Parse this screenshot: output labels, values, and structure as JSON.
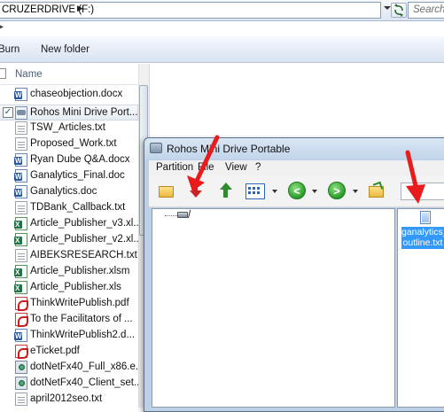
{
  "address_bar": {
    "path": "CRUZERDRIVE (F:)",
    "search_placeholder": "Search"
  },
  "toolbar": {
    "burn_label": "Burn",
    "new_folder_label": "New folder"
  },
  "file_list": {
    "column_header": "Name",
    "files": [
      {
        "name": "chaseobjection.docx",
        "icon": "word-doc-icon",
        "selected": false
      },
      {
        "name": "Rohos Mini Drive Port...",
        "icon": "app-icon",
        "selected": true
      },
      {
        "name": "TSW_Articles.txt",
        "icon": "text-file-icon",
        "selected": false
      },
      {
        "name": "Proposed_Work.txt",
        "icon": "text-file-icon",
        "selected": false
      },
      {
        "name": "Ryan Dube Q&A.docx",
        "icon": "word-doc-icon",
        "selected": false
      },
      {
        "name": "Ganalytics_Final.doc",
        "icon": "word-doc-icon",
        "selected": false
      },
      {
        "name": "Ganalytics.doc",
        "icon": "word-doc-icon",
        "selected": false
      },
      {
        "name": "TDBank_Callback.txt",
        "icon": "text-file-icon",
        "selected": false
      },
      {
        "name": "Article_Publisher_v3.xl...",
        "icon": "excel-file-icon",
        "selected": false
      },
      {
        "name": "Article_Publisher_v2.xl...",
        "icon": "excel-file-icon",
        "selected": false
      },
      {
        "name": "AIBEKSRESEARCH.txt",
        "icon": "text-file-icon",
        "selected": false
      },
      {
        "name": "Article_Publisher.xlsm",
        "icon": "excel-file-icon",
        "selected": false
      },
      {
        "name": "Article_Publisher.xls",
        "icon": "excel-file-icon",
        "selected": false
      },
      {
        "name": "ThinkWritePublish.pdf",
        "icon": "pdf-file-icon",
        "selected": false
      },
      {
        "name": "To the Facilitators of ...",
        "icon": "pdf-file-icon",
        "selected": false
      },
      {
        "name": "ThinkWritePublish2.d...",
        "icon": "word-doc-icon",
        "selected": false
      },
      {
        "name": "eTicket.pdf",
        "icon": "pdf-file-icon",
        "selected": false
      },
      {
        "name": "dotNetFx40_Full_x86.e...",
        "icon": "installer-icon",
        "selected": false
      },
      {
        "name": "dotNetFx40_Client_set...",
        "icon": "installer-icon",
        "selected": false
      },
      {
        "name": "april2012seo.txt",
        "icon": "text-file-icon",
        "selected": false
      }
    ]
  },
  "rohos_window": {
    "title": "Rohos Mini Drive Portable",
    "menu": [
      "Partition",
      "File",
      "View",
      "?"
    ],
    "tree_root": "/",
    "file_item": "ganalytics_outline.txt",
    "file_item_display": "ganalytics_\noutline.txt"
  },
  "colors": {
    "selection_blue": "#3399ff",
    "annotation_red": "#e81c1c",
    "explorer_toolbar": "#dde6f1"
  }
}
